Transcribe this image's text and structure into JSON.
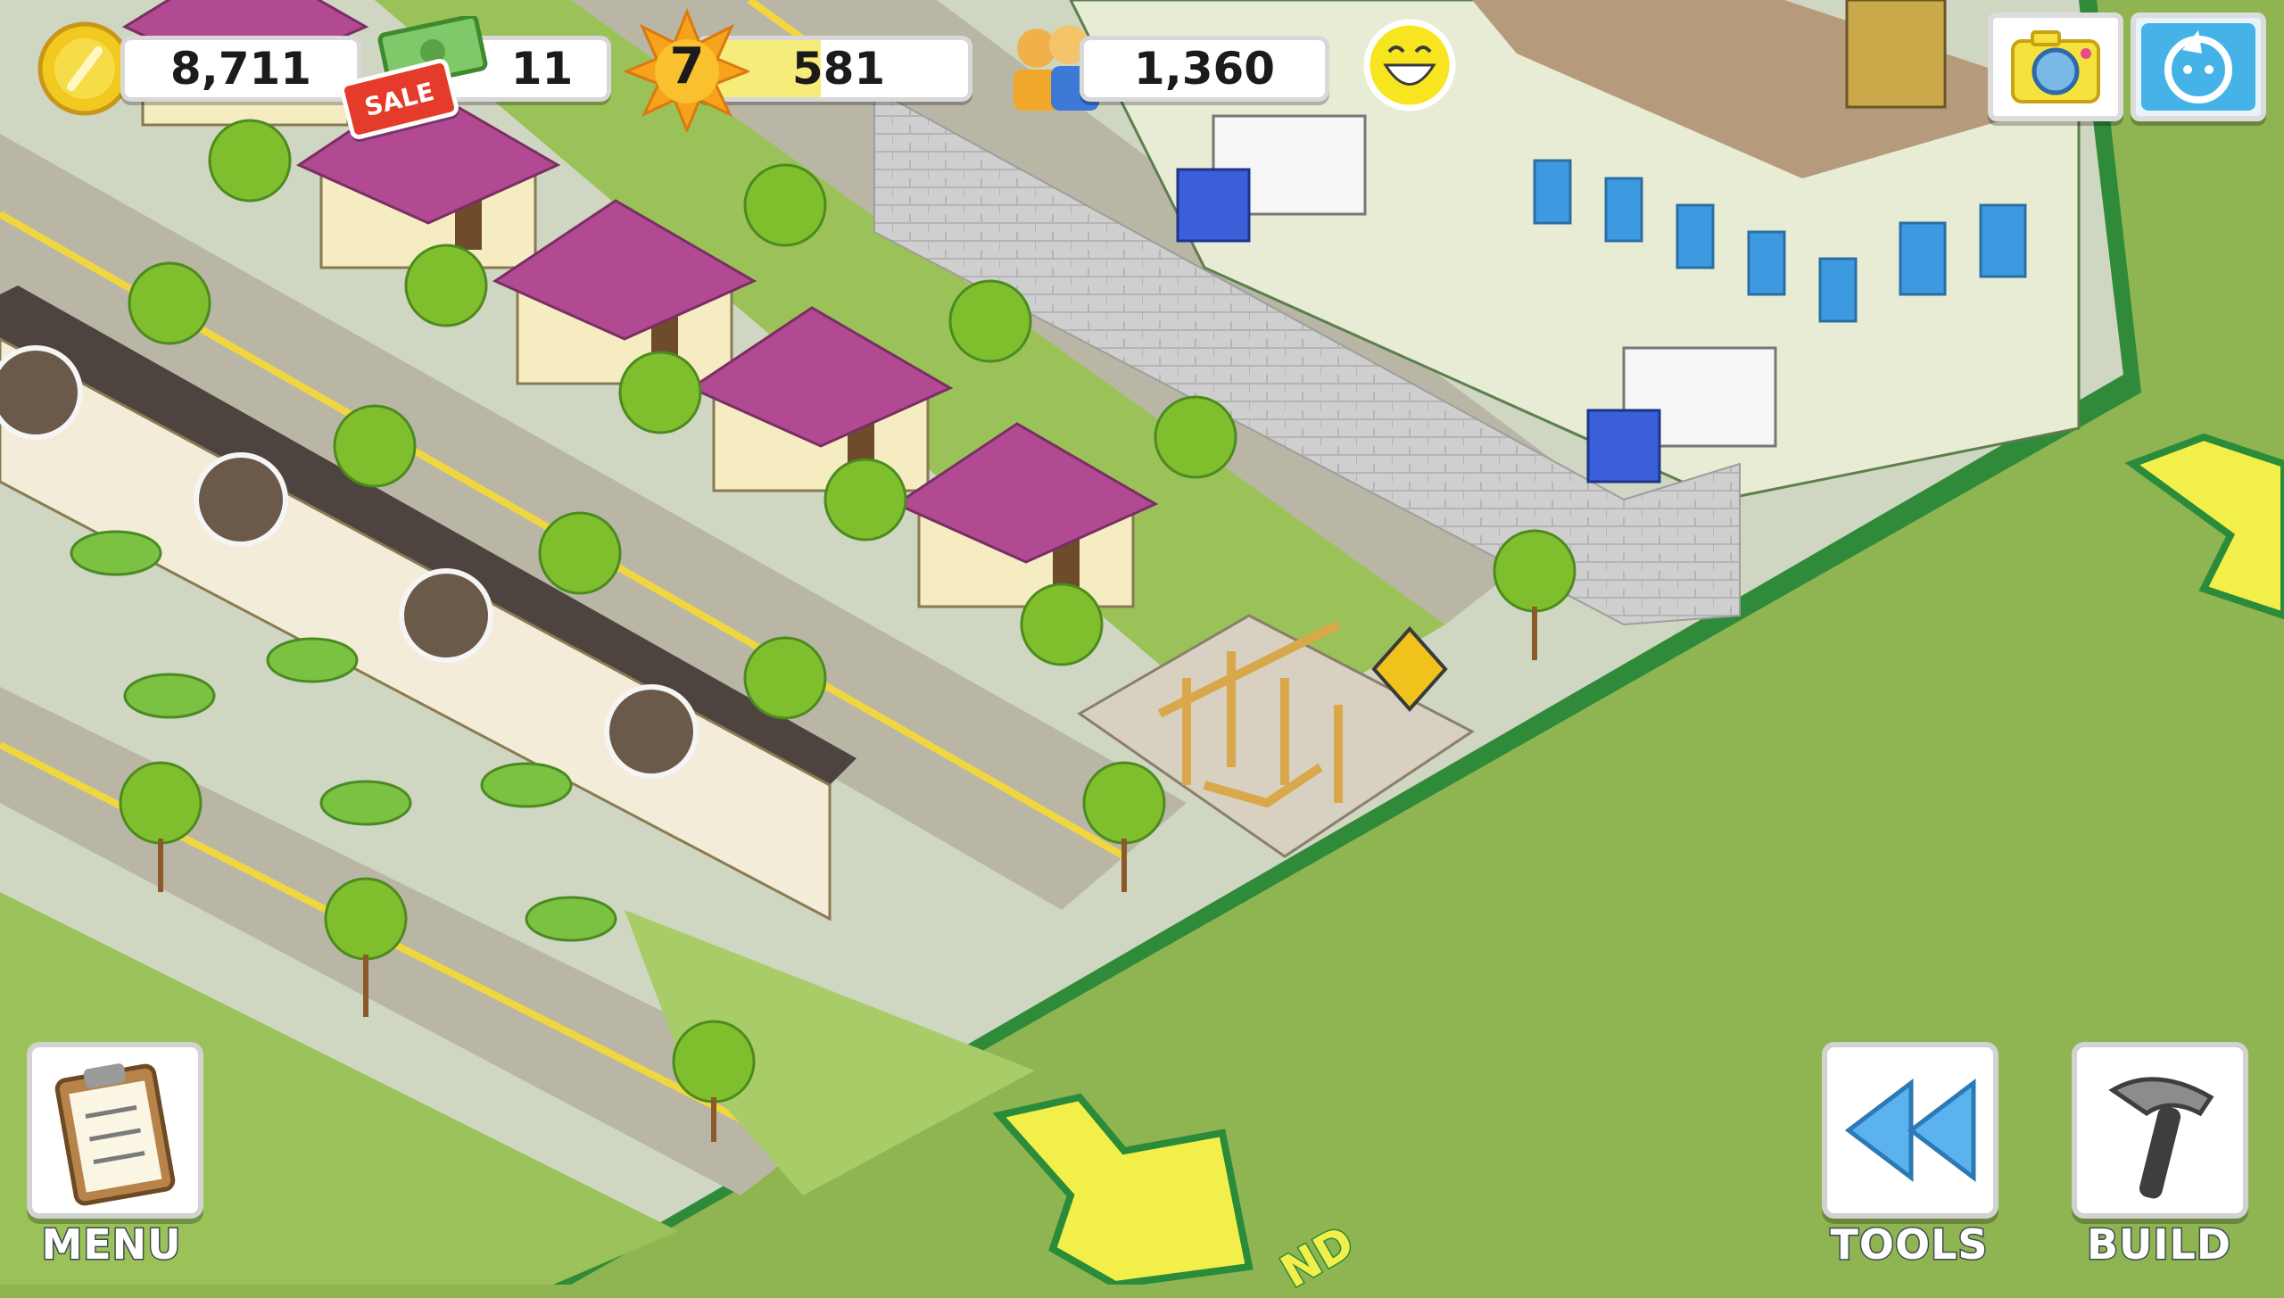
{
  "hud": {
    "coins": "8,711",
    "cash": "11",
    "sale_badge": "SALE",
    "level": "7",
    "xp": "581",
    "xp_progress": 0.45,
    "population": "1,360",
    "happiness_icon": "smiley-face-icon"
  },
  "top_right": {
    "camera_icon": "camera-icon",
    "social_icon": "social-network-icon"
  },
  "buttons": {
    "menu": "MENU",
    "tools": "TOOLS",
    "build": "BUILD"
  },
  "map": {
    "expand_arrow_label": "ND"
  },
  "colors": {
    "grass": "#8fb552",
    "road": "#b9b6a6",
    "roof": "#b24a93",
    "arrow": "#f3ef4a",
    "xp_bar": "#f5ec7a"
  }
}
